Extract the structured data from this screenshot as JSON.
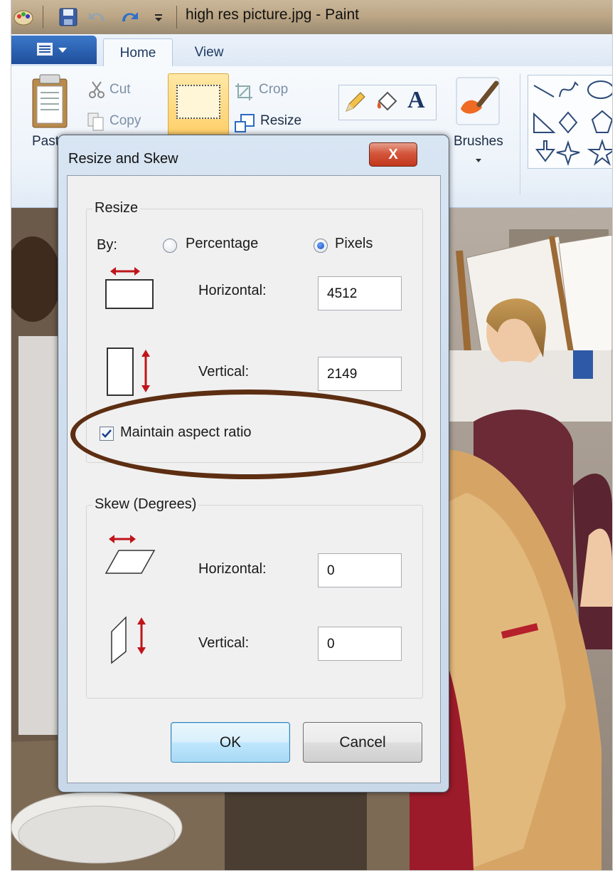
{
  "window": {
    "title": "high res picture.jpg - Paint",
    "quick_access": [
      "paint-app-icon",
      "save-icon",
      "undo-icon",
      "redo-icon",
      "customize-dropdown-icon"
    ]
  },
  "ribbon": {
    "tabs": [
      {
        "label": "Home",
        "active": true
      },
      {
        "label": "View",
        "active": false
      }
    ],
    "clipboard": {
      "paste_label": "Past",
      "cut_label": "Cut",
      "copy_label": "Copy"
    },
    "image": {
      "crop_label": "Crop",
      "resize_label": "Resize"
    },
    "tools": {
      "text_tool_glyph": "A"
    },
    "brushes_label": "Brushes"
  },
  "dialog": {
    "title": "Resize and Skew",
    "close_glyph": "X",
    "resize": {
      "group_label": "Resize",
      "by_label": "By:",
      "options": [
        {
          "label": "Percentage",
          "selected": false
        },
        {
          "label": "Pixels",
          "selected": true
        }
      ],
      "horizontal_label": "Horizontal:",
      "horizontal_value": "4512",
      "vertical_label": "Vertical:",
      "vertical_value": "2149",
      "maintain_aspect_label": "Maintain aspect ratio",
      "maintain_aspect_checked": true
    },
    "skew": {
      "group_label": "Skew (Degrees)",
      "horizontal_label": "Horizontal:",
      "horizontal_value": "0",
      "vertical_label": "Vertical:",
      "vertical_value": "0"
    },
    "ok_label": "OK",
    "cancel_label": "Cancel"
  },
  "colors": {
    "annotation_oval": "#5d2e12",
    "resize_arrow": "#c0141a",
    "title_bar": "#bda786",
    "dialog_frame": "#cfdeee"
  }
}
